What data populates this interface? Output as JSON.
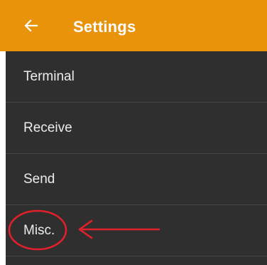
{
  "app_bar": {
    "title": "Settings",
    "back_icon": "arrow-left-icon",
    "color": "#E8930A"
  },
  "settings_list": {
    "items": [
      {
        "label": "Terminal"
      },
      {
        "label": "Receive"
      },
      {
        "label": "Send"
      },
      {
        "label": "Misc."
      }
    ],
    "background": "#2F2F2F"
  },
  "annotation": {
    "target": "Misc.",
    "color": "#E0202A",
    "shapes": [
      "circle",
      "arrow"
    ]
  }
}
